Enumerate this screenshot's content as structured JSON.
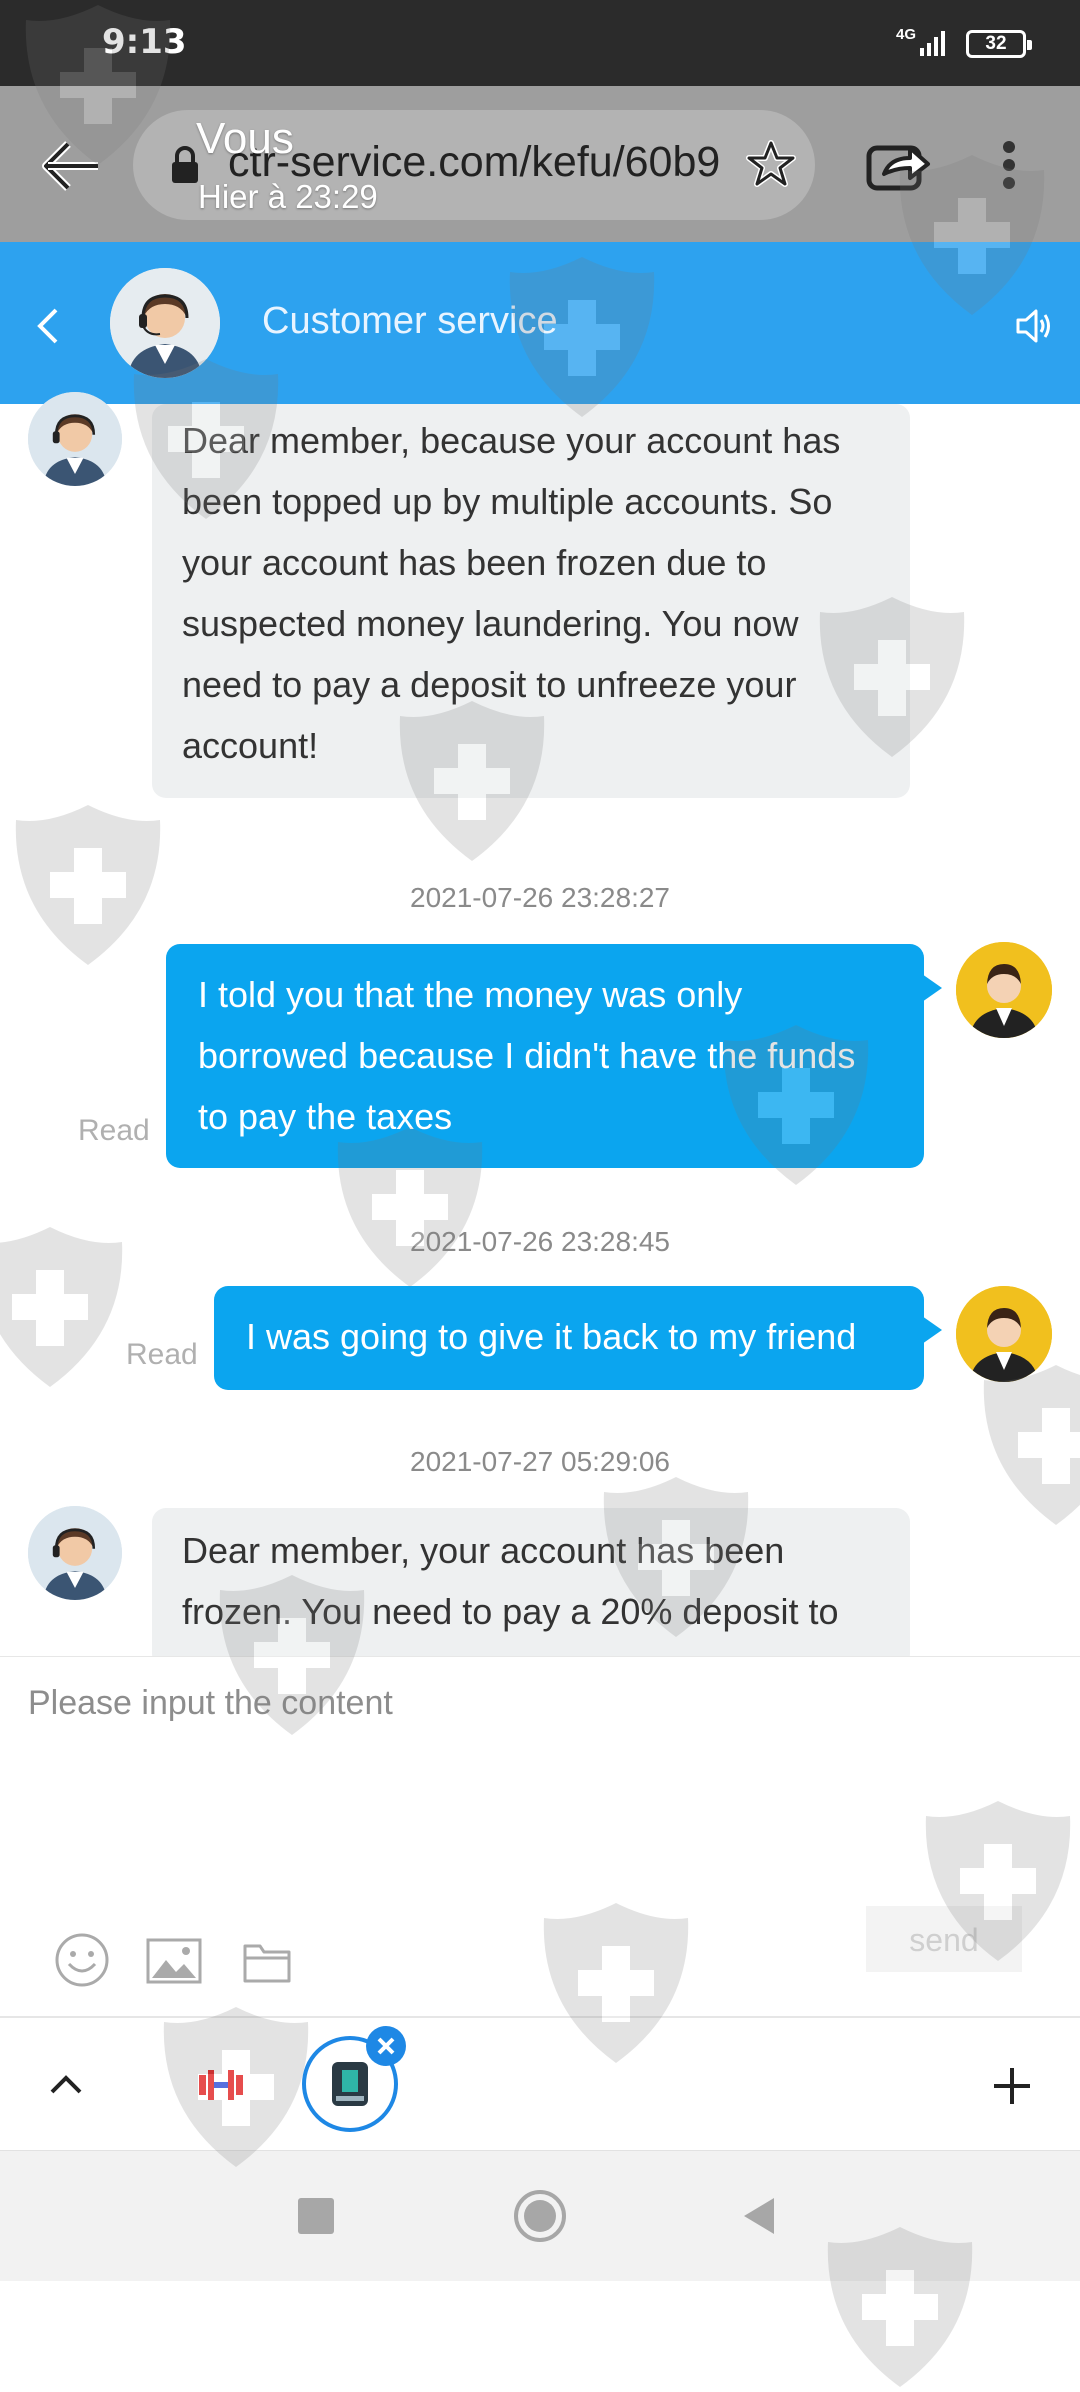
{
  "status_bar": {
    "time": "9:13",
    "network": "4G",
    "battery": "32"
  },
  "browser": {
    "url": "ctr-service.com/kefu/60b9",
    "notification": {
      "sender": "Vous",
      "time": "Hier à 23:29"
    }
  },
  "header": {
    "title": "Customer service"
  },
  "messages": [
    {
      "lines": [
        "Dear member, because your account has",
        "been topped up by multiple accounts. So",
        "your account has been frozen due to",
        "suspected money laundering. You now",
        "need to pay a deposit to unfreeze your",
        "account!"
      ]
    },
    {
      "timestamp": "2021-07-26 23:28:27",
      "lines": [
        "I told you that the money was only",
        "borrowed because I didn't have the funds",
        "to pay the taxes"
      ],
      "status": "Read"
    },
    {
      "timestamp": "2021-07-26 23:28:45",
      "lines": [
        "I was going to give it back to my friend"
      ],
      "status": "Read"
    },
    {
      "timestamp": "2021-07-27 05:29:06",
      "lines": [
        "Dear member, your account has been",
        "frozen. You need to pay a 20% deposit to"
      ]
    }
  ],
  "input": {
    "placeholder": "Please input the content",
    "send_label": "send"
  },
  "icons": {
    "back": "back-arrow-icon",
    "share": "share-icon",
    "menu": "more-vert-icon",
    "star": "star-icon",
    "speaker": "speaker-icon",
    "emoji": "emoji-icon",
    "image": "image-icon",
    "folder": "folder-icon",
    "plus": "plus-icon"
  },
  "colors": {
    "header": "#2da2ef",
    "outgoing_bubble": "#0ba5ef",
    "incoming_bubble": "#eef0f1",
    "status_bar": "#2b2b2b"
  }
}
